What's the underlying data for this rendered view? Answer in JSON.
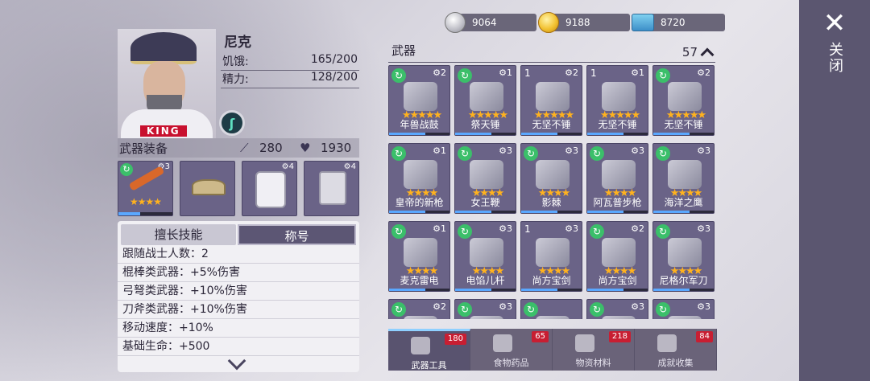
{
  "header": {
    "currencies": [
      {
        "icon": "silver-coin-icon",
        "value": "9064"
      },
      {
        "icon": "gold-coin-icon",
        "value": "9188"
      },
      {
        "icon": "ticket-icon",
        "value": "8720"
      }
    ],
    "close_label": "关闭",
    "close_glyph": "✕"
  },
  "character": {
    "name": "尼克",
    "badge_text": "KING",
    "stats": [
      {
        "label": "饥饿:",
        "value": "165/200"
      },
      {
        "label": "精力:",
        "value": "128/200"
      }
    ]
  },
  "equipment": {
    "title": "武器装备",
    "attack": "280",
    "health": "1930",
    "slots": [
      {
        "name": "weapon-slot",
        "level": "3",
        "stars": "★★★★",
        "has_cycle": true
      },
      {
        "name": "hat-slot",
        "level": "",
        "stars": "",
        "has_cycle": false
      },
      {
        "name": "jacket-slot",
        "level": "4",
        "stars": "",
        "has_cycle": false
      },
      {
        "name": "pants-slot",
        "level": "4",
        "stars": "",
        "has_cycle": false
      }
    ]
  },
  "skills": {
    "tab_active": "擅长技能",
    "tab_other": "称号",
    "lines": [
      "跟随战士人数：2",
      "棍棒类武器：+5%伤害",
      "弓弩类武器：+10%伤害",
      "刀斧类武器：+10%伤害",
      "移动速度：+10%",
      "基础生命：+500"
    ]
  },
  "weapons": {
    "title": "武器",
    "count": "57",
    "items": [
      {
        "name": "年兽战鼓",
        "level": "2",
        "qty": "",
        "stars": "★★★★★",
        "cycle": true
      },
      {
        "name": "祭天锤",
        "level": "1",
        "qty": "",
        "stars": "★★★★★",
        "cycle": true
      },
      {
        "name": "无坚不锤",
        "level": "2",
        "qty": "1",
        "stars": "★★★★★",
        "cycle": false
      },
      {
        "name": "无坚不锤",
        "level": "1",
        "qty": "1",
        "stars": "★★★★★",
        "cycle": false
      },
      {
        "name": "无坚不锤",
        "level": "2",
        "qty": "",
        "stars": "★★★★★",
        "cycle": true
      },
      {
        "name": "皇帝的新枪",
        "level": "1",
        "qty": "",
        "stars": "★★★★",
        "cycle": true
      },
      {
        "name": "女王鞭",
        "level": "3",
        "qty": "",
        "stars": "★★★★",
        "cycle": true
      },
      {
        "name": "影棘",
        "level": "3",
        "qty": "",
        "stars": "★★★★",
        "cycle": true
      },
      {
        "name": "阿瓦普步枪",
        "level": "3",
        "qty": "",
        "stars": "★★★★",
        "cycle": true
      },
      {
        "name": "海洋之鹰",
        "level": "3",
        "qty": "",
        "stars": "★★★★",
        "cycle": true
      },
      {
        "name": "麦克雷电",
        "level": "1",
        "qty": "",
        "stars": "★★★★",
        "cycle": true
      },
      {
        "name": "电馅儿杆",
        "level": "3",
        "qty": "",
        "stars": "★★★★",
        "cycle": true
      },
      {
        "name": "尚方宝剑",
        "level": "3",
        "qty": "1",
        "stars": "★★★★",
        "cycle": false
      },
      {
        "name": "尚方宝剑",
        "level": "2",
        "qty": "",
        "stars": "★★★★",
        "cycle": true
      },
      {
        "name": "尼格尔军刀",
        "level": "3",
        "qty": "",
        "stars": "★★★★",
        "cycle": true
      },
      {
        "name": "",
        "level": "2",
        "qty": "",
        "stars": "",
        "cycle": true
      },
      {
        "name": "",
        "level": "3",
        "qty": "",
        "stars": "",
        "cycle": true
      },
      {
        "name": "",
        "level": "",
        "qty": "",
        "stars": "",
        "cycle": true
      },
      {
        "name": "",
        "level": "3",
        "qty": "",
        "stars": "",
        "cycle": true
      },
      {
        "name": "",
        "level": "3",
        "qty": "",
        "stars": "",
        "cycle": true
      }
    ]
  },
  "bottom_tabs": [
    {
      "label": "武器工具",
      "badge": "180",
      "icon": "tools-icon",
      "active": true
    },
    {
      "label": "食物药品",
      "badge": "65",
      "icon": "food-icon",
      "active": false
    },
    {
      "label": "物资材料",
      "badge": "218",
      "icon": "materials-icon",
      "active": false
    },
    {
      "label": "成就收集",
      "badge": "84",
      "icon": "trophy-icon",
      "active": false
    }
  ]
}
